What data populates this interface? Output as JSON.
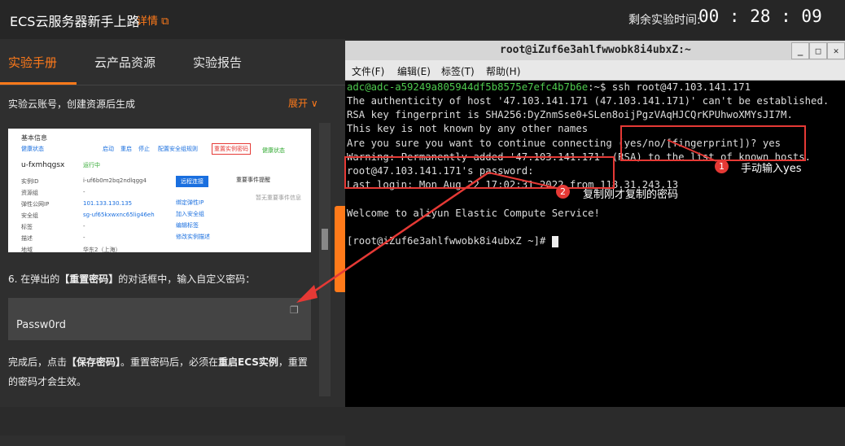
{
  "header": {
    "title": "ECS云服务器新手上路",
    "detail_link": "详情",
    "timer_label": "剩余实验时间:",
    "timer": "00 : 28 : 09"
  },
  "tabs": [
    {
      "label": "实验手册"
    },
    {
      "label": "云产品资源"
    },
    {
      "label": "实验报告"
    }
  ],
  "step": {
    "text": "实验云账号，创建资源后生成",
    "expand": "展开"
  },
  "screenshot": {
    "section": "基本信息",
    "instance_id": "u-fxmhqgsx",
    "status": "运行中",
    "labels": [
      "实例ID",
      "资源组",
      "弹性公网IP",
      "安全组",
      "标签",
      "描述",
      "地域"
    ],
    "values": [
      "i-uf6b0m2bq2ndlqgg4",
      "-",
      "101.133.130.135",
      "sg-uf65kxwxnc65lig46eh",
      "-",
      "-",
      "华东2（上海）"
    ],
    "actions": [
      "远程连接",
      "重置实例密码",
      "配置安全组规则",
      "启动",
      "重启",
      "停止"
    ],
    "side_labels": [
      "健康状态",
      "重要事件提醒",
      "暂无重要事件信息",
      "绑定弹性IP",
      "加入安全组",
      "编辑标签",
      "修改实例描述"
    ],
    "health": "健康状态"
  },
  "instr6": {
    "prefix": "6. 在弹出的",
    "bold": "【重置密码】",
    "suffix": "的对话框中，输入自定义密码："
  },
  "password": "Passw0rd",
  "instr7": {
    "a": "完成后，点击",
    "b": "【保存密码】",
    "c": "。重置密码后，必须在",
    "d": "重启ECS实例",
    "e": "，重置的密码才会生效。"
  },
  "terminal": {
    "title": "root@iZuf6e3ahlfwwobk8i4ubxZ:~",
    "menu": [
      "文件(F)",
      "编辑(E)",
      "标签(T)",
      "帮助(H)"
    ],
    "prompt1": "adc@adc-a59249a805944df5b8575e7efc4b7b6e",
    "prompt1_suffix": ":~$ ssh root@47.103.141.171",
    "lines": [
      "The authenticity of host '47.103.141.171 (47.103.141.171)' can't be established.",
      "RSA key fingerprint is SHA256:DyZnmSse0+SLen8oijPgzVAqHJCQrKPUhwoXMYsJI7M.",
      "This key is not known by any other names",
      "Are you sure you want to continue connecting (yes/no/[fingerprint])? yes",
      "Warning: Permanently added '47.103.141.171' (RSA) to the list of known hosts.",
      "root@47.103.141.171's password:",
      "Last login: Mon Aug 22 17:02:31 2022 from 118.31.243.13",
      "",
      "Welcome to aliyun Elastic Compute Service!",
      "",
      "[root@iZuf6e3ahlfwwobk8i4ubxZ ~]# "
    ]
  },
  "annotations": [
    {
      "num": "1",
      "text": "手动输入yes"
    },
    {
      "num": "2",
      "text": "复制刚才复制的密码"
    }
  ],
  "colors": {
    "accent": "#ff7a1a",
    "annotation": "#e53935",
    "prompt": "#4ec94e"
  }
}
